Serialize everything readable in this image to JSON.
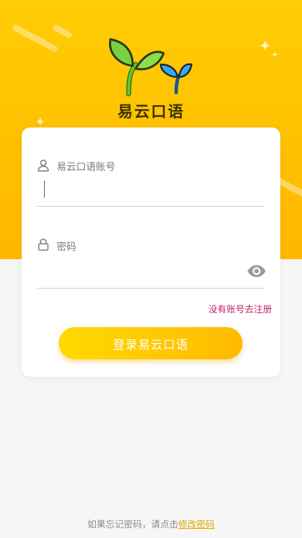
{
  "app": {
    "name": "易云口语"
  },
  "login_form": {
    "account_label": "易云口语账号",
    "account_value": "",
    "password_label": "密码",
    "password_value": "",
    "register_link": "没有账号去注册",
    "login_button": "登录易云口语"
  },
  "footer": {
    "prompt_text": "如果忘记密码，请点击",
    "change_password_link": "修改密码"
  },
  "icons": {
    "account": "user-icon",
    "password": "lock-icon",
    "show_password": "eye-icon",
    "logo": "sprout-logo-icon"
  },
  "colors": {
    "brand_yellow": "#ffc000",
    "register_link": "#c0266b",
    "footer_link": "#e0a800",
    "background": "#f6f6f6"
  }
}
